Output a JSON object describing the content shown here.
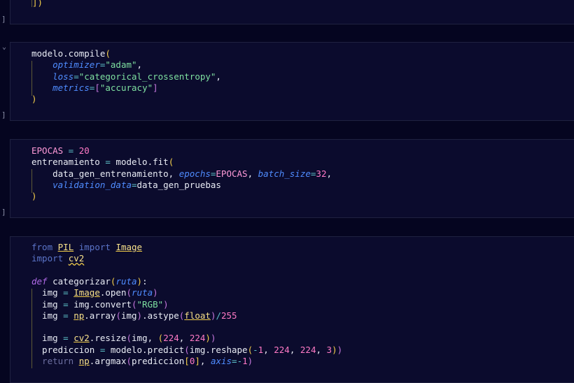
{
  "cells": [
    {
      "id": "cell-1",
      "lines": [
        [
          [
            "br",
            "])"
          ]
        ]
      ]
    },
    {
      "id": "cell-2",
      "lines": [
        [
          [
            "fn",
            "modelo.compile"
          ],
          [
            "br",
            "("
          ]
        ],
        [
          [
            "fn",
            "    "
          ],
          [
            "param",
            "optimizer"
          ],
          [
            "op",
            "="
          ],
          [
            "str",
            "\"adam\""
          ],
          [
            "fn",
            ","
          ]
        ],
        [
          [
            "fn",
            "    "
          ],
          [
            "param",
            "loss"
          ],
          [
            "op",
            "="
          ],
          [
            "str",
            "\"categorical_crossentropy\""
          ],
          [
            "fn",
            ","
          ]
        ],
        [
          [
            "fn",
            "    "
          ],
          [
            "param",
            "metrics"
          ],
          [
            "op",
            "="
          ],
          [
            "br2",
            "["
          ],
          [
            "str",
            "\"accuracy\""
          ],
          [
            "br2",
            "]"
          ]
        ],
        [
          [
            "br",
            ")"
          ]
        ]
      ]
    },
    {
      "id": "cell-3",
      "lines": [
        [
          [
            "const",
            "EPOCAS"
          ],
          [
            "op",
            " = "
          ],
          [
            "num",
            "20"
          ]
        ],
        [
          [
            "fn",
            "entrenamiento "
          ],
          [
            "op",
            "="
          ],
          [
            "fn",
            " modelo.fit"
          ],
          [
            "br",
            "("
          ]
        ],
        [
          [
            "fn",
            "    data_gen_entrenamiento, "
          ],
          [
            "param",
            "epochs"
          ],
          [
            "op",
            "="
          ],
          [
            "const",
            "EPOCAS"
          ],
          [
            "fn",
            ", "
          ],
          [
            "param",
            "batch_size"
          ],
          [
            "op",
            "="
          ],
          [
            "num",
            "32"
          ],
          [
            "fn",
            ","
          ]
        ],
        [
          [
            "fn",
            "    "
          ],
          [
            "param",
            "validation_data"
          ],
          [
            "op",
            "="
          ],
          [
            "fn",
            "data_gen_pruebas"
          ]
        ],
        [
          [
            "br",
            ")"
          ]
        ]
      ]
    },
    {
      "id": "cell-4",
      "lines": [
        [
          [
            "kw",
            "from "
          ],
          [
            "mod",
            "PIL"
          ],
          [
            "kw",
            " import "
          ],
          [
            "mod",
            "Image"
          ]
        ],
        [
          [
            "kw",
            "import "
          ],
          [
            "modw",
            "cv2"
          ]
        ],
        [],
        [
          [
            "def",
            "def "
          ],
          [
            "fn",
            "categorizar"
          ],
          [
            "br",
            "("
          ],
          [
            "param",
            "ruta"
          ],
          [
            "br",
            ")"
          ],
          [
            "fn",
            ":"
          ]
        ],
        [
          [
            "fn",
            "  img "
          ],
          [
            "op",
            "="
          ],
          [
            "fn",
            " "
          ],
          [
            "mod",
            "Image"
          ],
          [
            "fn",
            ".open"
          ],
          [
            "br2",
            "("
          ],
          [
            "param",
            "ruta"
          ],
          [
            "br2",
            ")"
          ]
        ],
        [
          [
            "fn",
            "  img "
          ],
          [
            "op",
            "="
          ],
          [
            "fn",
            " img.convert"
          ],
          [
            "br2",
            "("
          ],
          [
            "str",
            "\"RGB\""
          ],
          [
            "br2",
            ")"
          ]
        ],
        [
          [
            "fn",
            "  img "
          ],
          [
            "op",
            "="
          ],
          [
            "fn",
            " "
          ],
          [
            "mod",
            "np"
          ],
          [
            "fn",
            ".array"
          ],
          [
            "br2",
            "("
          ],
          [
            "fn",
            "img"
          ],
          [
            "br2",
            ")"
          ],
          [
            "fn",
            ".astype"
          ],
          [
            "br2",
            "("
          ],
          [
            "mod",
            "float"
          ],
          [
            "br2",
            ")"
          ],
          [
            "op",
            "/"
          ],
          [
            "num",
            "255"
          ]
        ],
        [],
        [
          [
            "fn",
            "  img "
          ],
          [
            "op",
            "="
          ],
          [
            "fn",
            " "
          ],
          [
            "mod",
            "cv2"
          ],
          [
            "fn",
            ".resize"
          ],
          [
            "br2",
            "("
          ],
          [
            "fn",
            "img, "
          ],
          [
            "br",
            "("
          ],
          [
            "num",
            "224"
          ],
          [
            "fn",
            ", "
          ],
          [
            "num",
            "224"
          ],
          [
            "br",
            ")"
          ],
          [
            "br2",
            ")"
          ]
        ],
        [
          [
            "fn",
            "  prediccion "
          ],
          [
            "op",
            "="
          ],
          [
            "fn",
            " modelo.predict"
          ],
          [
            "br2",
            "("
          ],
          [
            "fn",
            "img.reshape"
          ],
          [
            "br",
            "("
          ],
          [
            "op",
            "-"
          ],
          [
            "num",
            "1"
          ],
          [
            "fn",
            ", "
          ],
          [
            "num",
            "224"
          ],
          [
            "fn",
            ", "
          ],
          [
            "num",
            "224"
          ],
          [
            "fn",
            ", "
          ],
          [
            "num",
            "3"
          ],
          [
            "br",
            ")"
          ],
          [
            "br2",
            ")"
          ]
        ],
        [
          [
            "ret",
            "  return "
          ],
          [
            "mod",
            "np"
          ],
          [
            "fn",
            ".argmax"
          ],
          [
            "br2",
            "("
          ],
          [
            "fn",
            "prediccion"
          ],
          [
            "br",
            "["
          ],
          [
            "num",
            "0"
          ],
          [
            "br",
            "]"
          ],
          [
            "fn",
            ", "
          ],
          [
            "param",
            "axis"
          ],
          [
            "op",
            "=-"
          ],
          [
            "num",
            "1"
          ],
          [
            "br2",
            ")"
          ]
        ]
      ]
    }
  ],
  "gutter": {
    "bracket": "]",
    "chevron": "⌄"
  }
}
